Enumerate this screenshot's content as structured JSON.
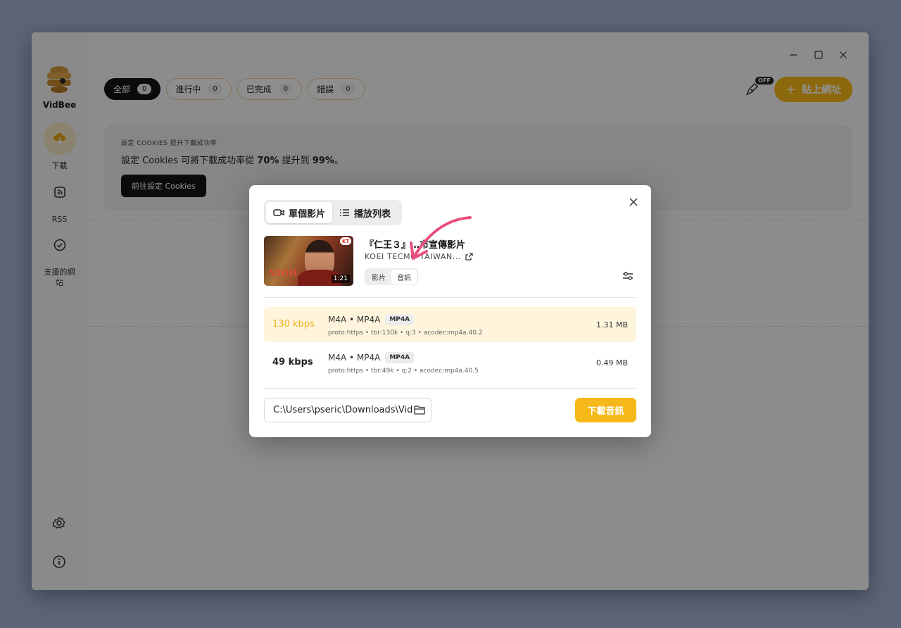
{
  "app": {
    "name": "VidBee"
  },
  "sidebar": {
    "items": [
      {
        "label": "下載",
        "icon": "download-icon"
      },
      {
        "label": "RSS",
        "icon": "rss-icon"
      },
      {
        "label": "支援的網站",
        "icon": "check-circle-icon"
      }
    ],
    "bottom_icons": [
      "settings-icon",
      "info-icon"
    ]
  },
  "tabs": [
    {
      "label": "全部",
      "count": "0"
    },
    {
      "label": "進行中",
      "count": "0"
    },
    {
      "label": "已完成",
      "count": "0"
    },
    {
      "label": "錯誤",
      "count": "0"
    }
  ],
  "header": {
    "auto_toggle_badge": "OFF",
    "paste_label": "貼上網址"
  },
  "cookie_banner": {
    "heading": "設定 COOKIES 提升下載成功率",
    "text_prefix": "設定 Cookies 可將下載成功率從 ",
    "from_pct": "70%",
    "text_mid": " 提升到 ",
    "to_pct": "99%",
    "text_suffix": "。",
    "button": "前往設定 Cookies"
  },
  "dialog": {
    "modes": [
      "單個影片",
      "播放列表"
    ],
    "video": {
      "title": "『仁王３』…市宣傳影片",
      "channel": "KOEI TECMO TAIWAN...",
      "duration": "1:21",
      "thumb_text": "NIOH",
      "thumb_badge": "KT"
    },
    "format_tabs": [
      "影片",
      "音訊"
    ],
    "selected_format_tab": "音訊",
    "options": [
      {
        "bitrate": "130 kbps",
        "format": "M4A • MP4A",
        "badge": "MP4A",
        "details": "proto:https • tbr:130k • q:3 • acodec:mp4a.40.2",
        "size": "1.31 MB",
        "selected": true
      },
      {
        "bitrate": "49 kbps",
        "format": "M4A • MP4A",
        "badge": "MP4A",
        "details": "proto:https • tbr:49k • q:2 • acodec:mp4a.40.5",
        "size": "0.49 MB",
        "selected": false
      }
    ],
    "path": "C:\\Users\\pseric\\Downloads\\VidBee",
    "download_label": "下載音訊"
  },
  "colors": {
    "accent": "#f6b818",
    "annotation_arrow": "#e84f7b"
  }
}
